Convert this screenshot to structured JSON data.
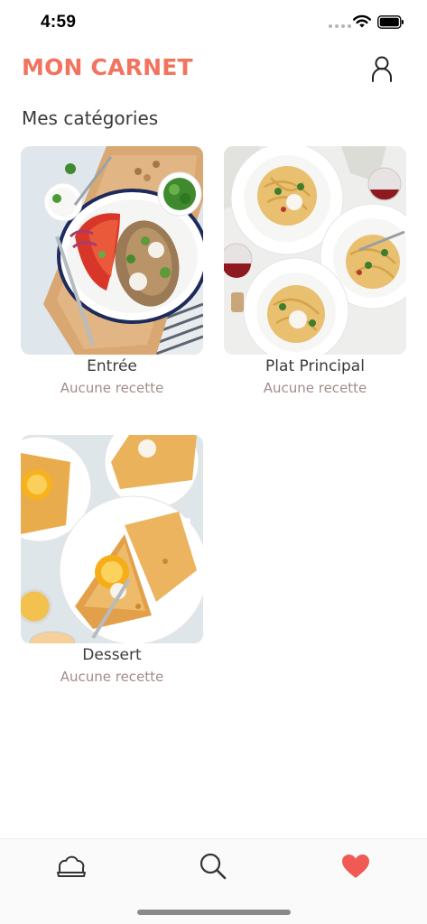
{
  "status_bar": {
    "time": "4:59"
  },
  "header": {
    "title": "MON CARNET",
    "profile_icon": "user-outline-icon"
  },
  "section_title": "Mes catégories",
  "categories": [
    {
      "name": "Entrée",
      "count_label": "Aucune recette",
      "image": "salad-platter-photo"
    },
    {
      "name": "Plat Principal",
      "count_label": "Aucune recette",
      "image": "pasta-plates-photo"
    },
    {
      "name": "Dessert",
      "count_label": "Aucune recette",
      "image": "crepes-photo"
    }
  ],
  "tab_bar": {
    "items": [
      {
        "icon": "chef-hat-icon",
        "active": false
      },
      {
        "icon": "search-icon",
        "active": false
      },
      {
        "icon": "heart-icon",
        "active": true
      }
    ]
  },
  "colors": {
    "accent": "#f2735e",
    "heart": "#ef5a55",
    "subtitle": "#a38c8c"
  }
}
